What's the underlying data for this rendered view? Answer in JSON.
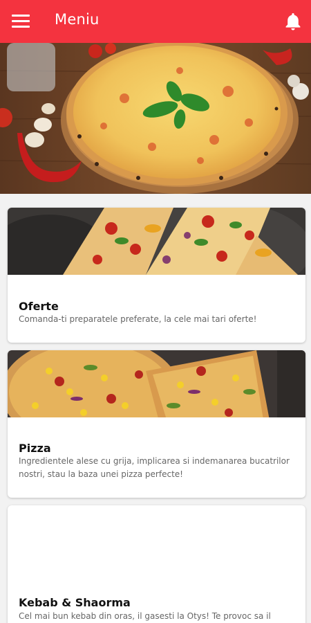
{
  "appbar": {
    "title": "Meniu",
    "menu_icon": "hamburger-menu-icon",
    "bell_icon": "notification-bell-icon",
    "color": "#f4333f"
  },
  "hero": {
    "image": "margherita-pizza-photo"
  },
  "categories": [
    {
      "title": "Oferte",
      "description": "Comanda-ti preparatele preferate, la cele mai tari oferte!",
      "image": "pizza-slices-photo"
    },
    {
      "title": "Pizza",
      "description": "Ingredientele alese cu grija, implicarea si indemanarea bucatrilor nostri, stau la baza unei pizza perfecte!",
      "image": "pizza-corn-photo"
    },
    {
      "title": "Kebab & Shaorma",
      "description": "Cel mai bun kebab din oras, il gasesti la Otys! Te provoc sa il",
      "image": ""
    }
  ]
}
